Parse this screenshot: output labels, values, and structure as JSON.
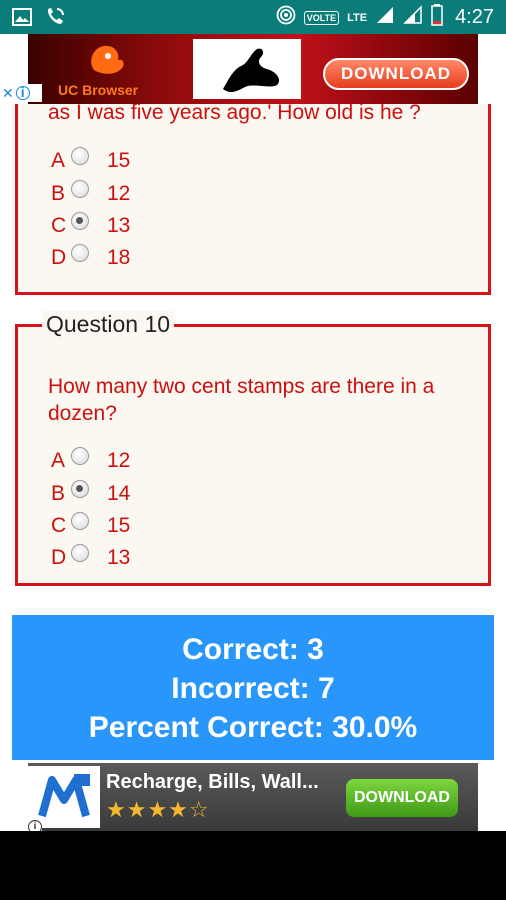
{
  "status_bar": {
    "volte": "VOLTE",
    "lte": "LTE",
    "time": "4:27",
    "icons": [
      "image-icon",
      "phone-wifi-icon",
      "hotspot-icon",
      "signal-icon",
      "signal-icon",
      "battery-icon"
    ]
  },
  "ad_top": {
    "brand": "UC Browser",
    "download_label": "DOWNLOAD"
  },
  "question9": {
    "text": "as I was five years ago.' How old is he ?",
    "options": [
      {
        "letter": "A",
        "value": "15",
        "selected": false
      },
      {
        "letter": "B",
        "value": "12",
        "selected": false
      },
      {
        "letter": "C",
        "value": "13",
        "selected": true
      },
      {
        "letter": "D",
        "value": "18",
        "selected": false
      }
    ]
  },
  "question10": {
    "legend": "Question 10",
    "text": "How many two cent stamps are there in a dozen?",
    "options": [
      {
        "letter": "A",
        "value": "12",
        "selected": false
      },
      {
        "letter": "B",
        "value": "14",
        "selected": true
      },
      {
        "letter": "C",
        "value": "15",
        "selected": false
      },
      {
        "letter": "D",
        "value": "13",
        "selected": false
      }
    ]
  },
  "score": {
    "correct": "Correct: 3",
    "incorrect": "Incorrect: 7",
    "percent": "Percent Correct: 30.0%"
  },
  "ad_bottom": {
    "title": "Recharge, Bills, Wall...",
    "stars": "★★★★☆",
    "download_label": "DOWNLOAD"
  },
  "colors": {
    "accent": "#d8121a",
    "score_bg": "#2996fb",
    "status_bar": "#0a7d7b"
  }
}
